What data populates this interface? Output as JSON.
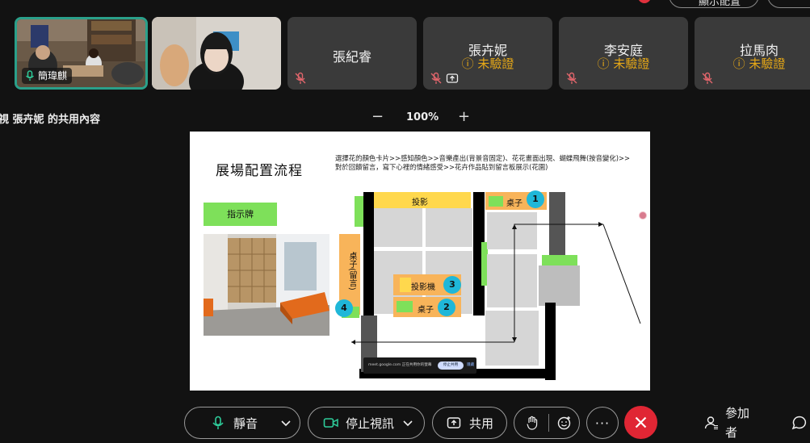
{
  "top": {
    "settings_label": "顯示配置"
  },
  "participants": [
    {
      "id": "video1",
      "name": "簡瑋麒",
      "has_video": true
    },
    {
      "id": "video2",
      "name": "",
      "has_video": true
    },
    {
      "id": "p3",
      "name": "張紀睿",
      "status": ""
    },
    {
      "id": "p4",
      "name": "張卉妮",
      "status": "未驗證"
    },
    {
      "id": "p5",
      "name": "李安庭",
      "status": "未驗證"
    },
    {
      "id": "p6",
      "name": "拉馬肉",
      "status": "未驗證"
    }
  ],
  "share": {
    "title": "視 張卉妮 的共用內容",
    "zoom": "100%",
    "zoom_out": "−",
    "zoom_in": "+"
  },
  "slide": {
    "title": "展場配置流程",
    "description": "選擇花的顏色卡片>>感知顏色>>音樂產出(背景音固定)、花花畫面出現、蝴蝶飛舞(按音變化)>>對於回饋留言，寫下心裡的情緒感受>>花卉作品貼到留言板展示(花園)",
    "sign": "指示牌",
    "projection": "投影",
    "table1": "桌子",
    "table2": "桌子",
    "projector": "投影機",
    "message_table": "桌子(留言)",
    "badges": [
      "1",
      "2",
      "3",
      "4"
    ],
    "mini_share_text": "meet.google.com 正在共用你的螢幕",
    "mini_share_stop": "停止共用",
    "mini_share_hide": "隱藏"
  },
  "toolbar": {
    "mute": "靜音",
    "stop_video": "停止視訊",
    "share": "共用",
    "participants": "參加者"
  },
  "colors": {
    "accent_teal": "#2aa08a",
    "end_call": "#e02634",
    "warning": "#e6a817",
    "slide_green": "#7ee05a",
    "slide_orange": "#f8b45a",
    "slide_yellow": "#ffd84d",
    "badge_cyan": "#1fb7d8"
  }
}
